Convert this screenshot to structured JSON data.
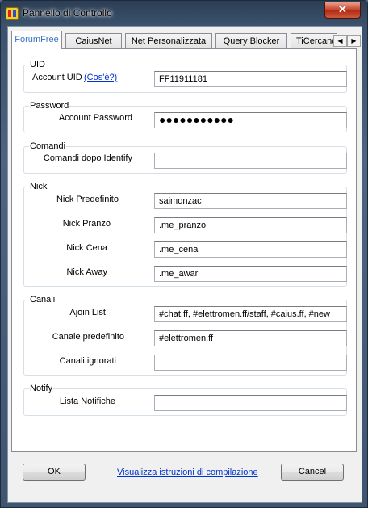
{
  "window": {
    "title": "Pannello di Controllo",
    "close_label": "✕"
  },
  "tabs": [
    {
      "label": "ForumFree",
      "active": true
    },
    {
      "label": "CaiusNet",
      "active": false
    },
    {
      "label": "Net Personalizzata",
      "active": false
    },
    {
      "label": "Query Blocker",
      "active": false
    },
    {
      "label": "TiCercano",
      "active": false
    }
  ],
  "tab_scroll": {
    "left": "◀",
    "right": "▶"
  },
  "groups": {
    "uid": {
      "title": "UID",
      "account_label": "Account UID",
      "account_link": "(Cos'è?)",
      "account_value": "FF11911181"
    },
    "password": {
      "title": "Password",
      "account_label": "Account Password",
      "account_value": "●●●●●●●●●●●"
    },
    "commands": {
      "title": "Comandi",
      "after_identify_label": "Comandi dopo Identify",
      "after_identify_value": ""
    },
    "nick": {
      "title": "Nick",
      "default_label": "Nick Predefinito",
      "default_value": "saimonzac",
      "lunch_label": "Nick Pranzo",
      "lunch_value": ".me_pranzo",
      "dinner_label": "Nick Cena",
      "dinner_value": ".me_cena",
      "away_label": "Nick Away",
      "away_value": ".me_awar"
    },
    "channels": {
      "title": "Canali",
      "autojoin_label": "Ajoin List",
      "autojoin_value": "#chat.ff, #elettromen.ff/staff, #caius.ff, #new",
      "default_label": "Canale predefinito",
      "default_value": "#elettromen.ff",
      "ignored_label": "Canali ignorati",
      "ignored_value": ""
    },
    "notify": {
      "title": "Notify",
      "list_label": "Lista Notifiche",
      "list_value": ""
    }
  },
  "footer": {
    "ok_label": "OK",
    "help_link": "Visualizza istruzioni di compilazione",
    "cancel_label": "Cancel"
  }
}
